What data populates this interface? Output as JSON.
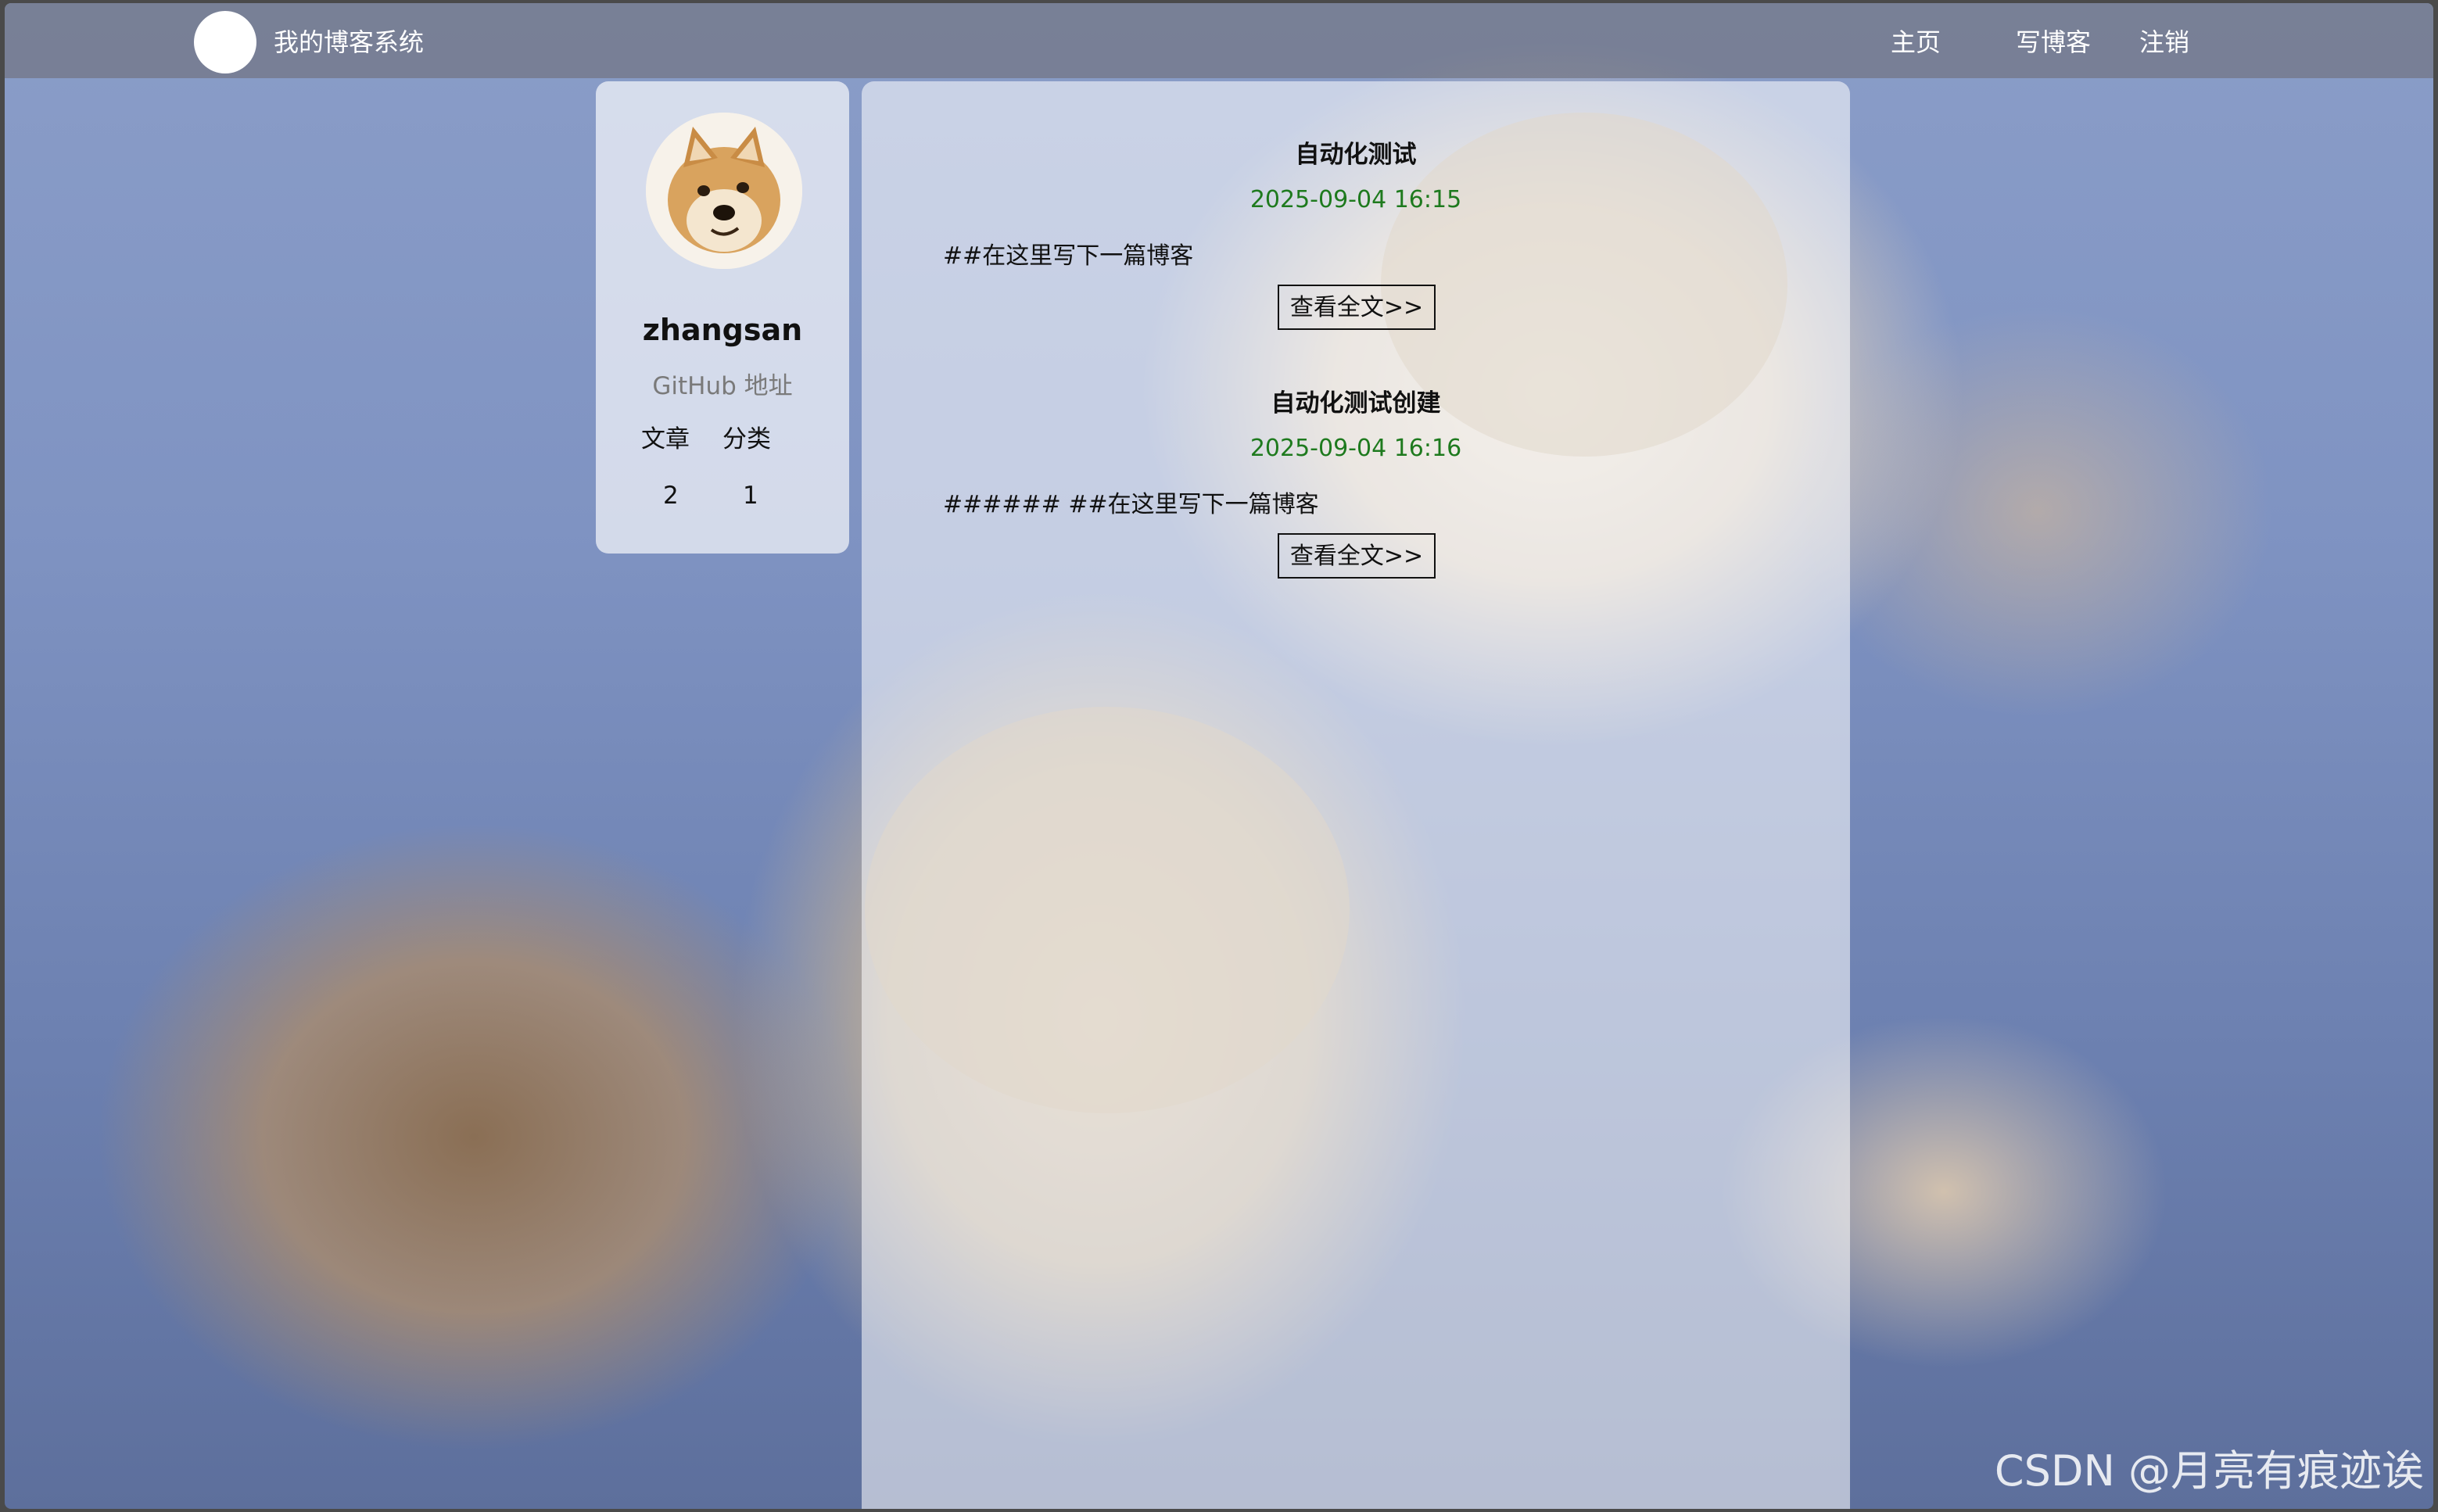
{
  "nav": {
    "site_title": "我的博客系统",
    "links": {
      "home": "主页",
      "write": "写博客",
      "logout": "注销"
    }
  },
  "profile": {
    "username": "zhangsan",
    "github_label": "GitHub 地址",
    "stats": {
      "articles_label": "文章",
      "categories_label": "分类",
      "articles_count": "2",
      "categories_count": "1"
    }
  },
  "blogs": [
    {
      "title": "自动化测试",
      "date": "2025-09-04 16:15",
      "summary": "##在这里写下一篇博客",
      "button_label": "查看全文>>"
    },
    {
      "title": "自动化测试创建",
      "date": "2025-09-04 16:16",
      "summary": "###### ##在这里写下一篇博客",
      "button_label": "查看全文>>"
    }
  ],
  "colors": {
    "date_color": "#1e7a1e",
    "nav_background": "rgba(110,110,120,0.62)"
  },
  "watermark": "CSDN @月亮有痕迹诶"
}
